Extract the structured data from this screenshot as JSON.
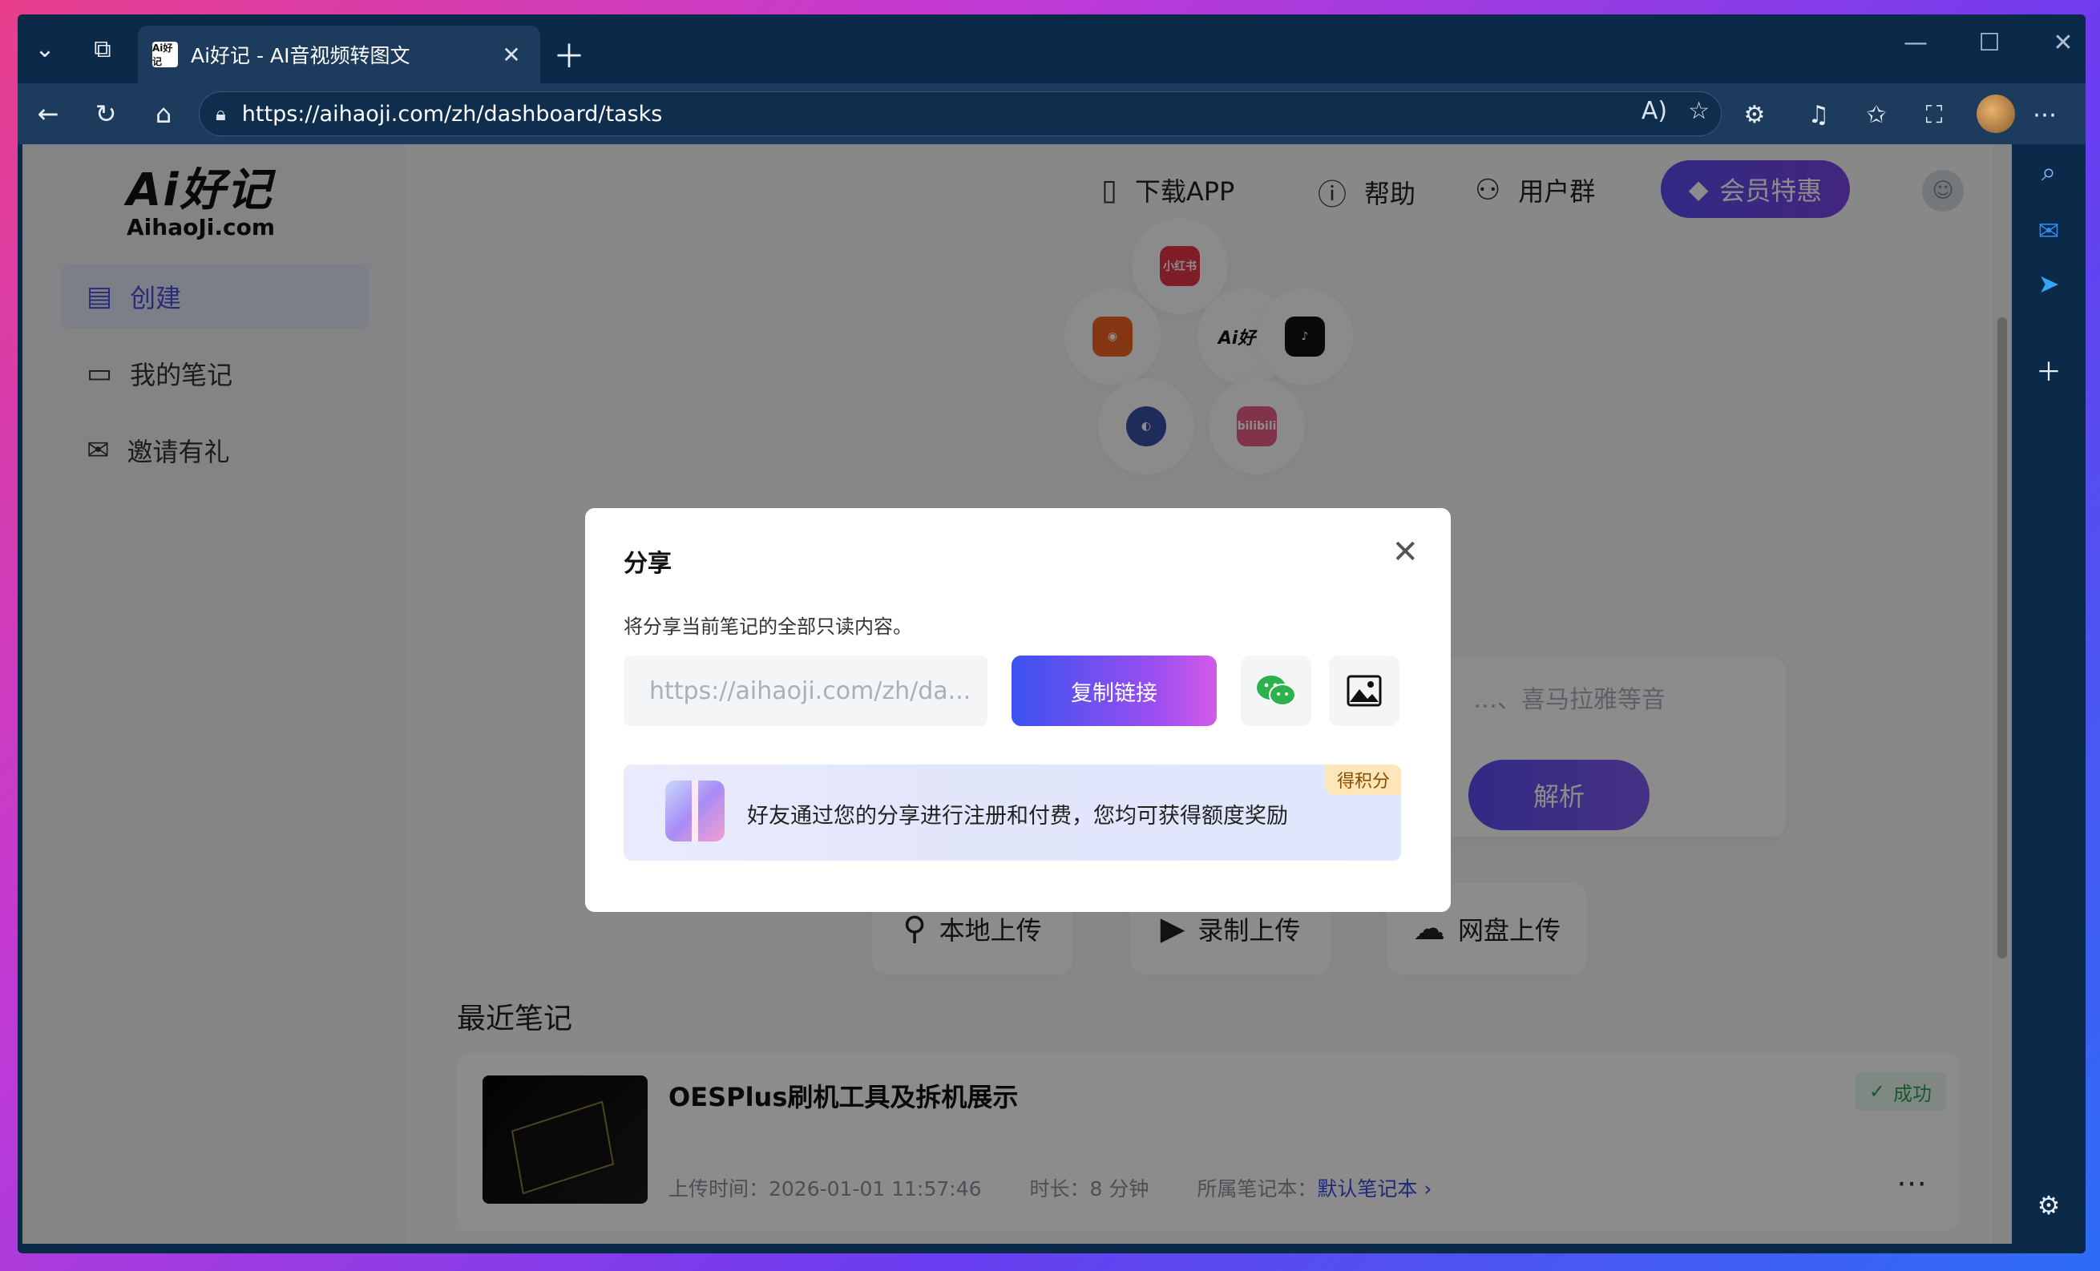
{
  "browser": {
    "tab_title": "Ai好记 - AI音视频转图文",
    "tab_favicon_text": "Ai好记",
    "url": "https://aihaoji.com/zh/dashboard/tasks"
  },
  "sidebar": {
    "logo_main": "Ai好记",
    "logo_sub": "AihaoJi.com",
    "items": [
      {
        "label": "创建",
        "icon": "create-note-icon",
        "active": true
      },
      {
        "label": "我的笔记",
        "icon": "folder-icon",
        "active": false
      },
      {
        "label": "邀请有礼",
        "icon": "invite-mail-icon",
        "active": false
      }
    ]
  },
  "topnav": {
    "download_app": "下载APP",
    "help": "帮助",
    "user_group": "用户群",
    "vip": "会员特惠"
  },
  "platforms": {
    "center_label": "Ai好记",
    "xiaohongshu": "小红书",
    "bilibili": "bilibili"
  },
  "input": {
    "placeholder_tail": "…、喜马拉雅等音",
    "parse_label": "解析"
  },
  "uploads": {
    "local": "本地上传",
    "record": "录制上传",
    "cloud": "网盘上传"
  },
  "recent": {
    "title": "最近笔记",
    "notes": [
      {
        "title": "OESPlus刷机工具及拆机展示",
        "status": "成功",
        "upload_time": "上传时间：2026-01-01 11:57:46",
        "duration": "时长：8 分钟",
        "notebook_prefix": "所属笔记本：",
        "notebook_name": "默认笔记本"
      }
    ]
  },
  "modal": {
    "title": "分享",
    "description": "将分享当前笔记的全部只读内容。",
    "link_value": "https://aihaoji.com/zh/da...",
    "copy_label": "复制链接",
    "reward_text": "好友通过您的分享进行注册和付费，您均可获得额度奖励",
    "reward_badge": "得积分"
  },
  "colors": {
    "accent": "#4a4fd6",
    "vip_gradient_start": "#5a4df0",
    "success": "#2ea35a",
    "wechat_green": "#2bb24c"
  }
}
